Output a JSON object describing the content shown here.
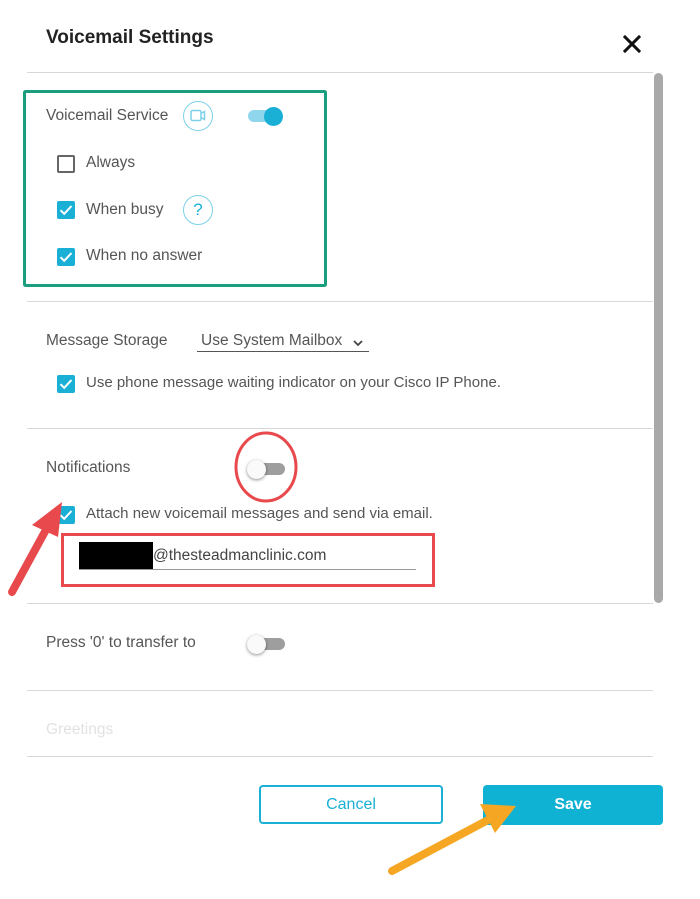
{
  "dialog": {
    "title": "Voicemail Settings",
    "close_icon": "close-icon"
  },
  "voicemail_service": {
    "label": "Voicemail Service",
    "icon": "video-camera-icon",
    "enabled": true,
    "options": [
      {
        "label": "Always",
        "checked": false
      },
      {
        "label": "When busy",
        "checked": true,
        "help_icon": "help-icon",
        "help_glyph": "?"
      },
      {
        "label": "When no answer",
        "checked": true
      }
    ]
  },
  "message_storage": {
    "label": "Message Storage",
    "selected": "Use System Mailbox",
    "mwi_label": "Use phone message waiting indicator on your Cisco IP Phone.",
    "mwi_checked": true
  },
  "notifications": {
    "label": "Notifications",
    "enabled": false,
    "attach_label": "Attach new voicemail messages and send via email.",
    "attach_checked": true,
    "email_value": "@thesteadmanclinic.com"
  },
  "transfer": {
    "label": "Press '0' to transfer to",
    "enabled": false
  },
  "greetings": {
    "label": "Greetings"
  },
  "buttons": {
    "cancel": "Cancel",
    "save": "Save"
  },
  "colors": {
    "accent": "#1ab0d6",
    "annotation_green": "#1b9e7e",
    "annotation_red": "#e8494c",
    "annotation_orange": "#f5a623"
  }
}
